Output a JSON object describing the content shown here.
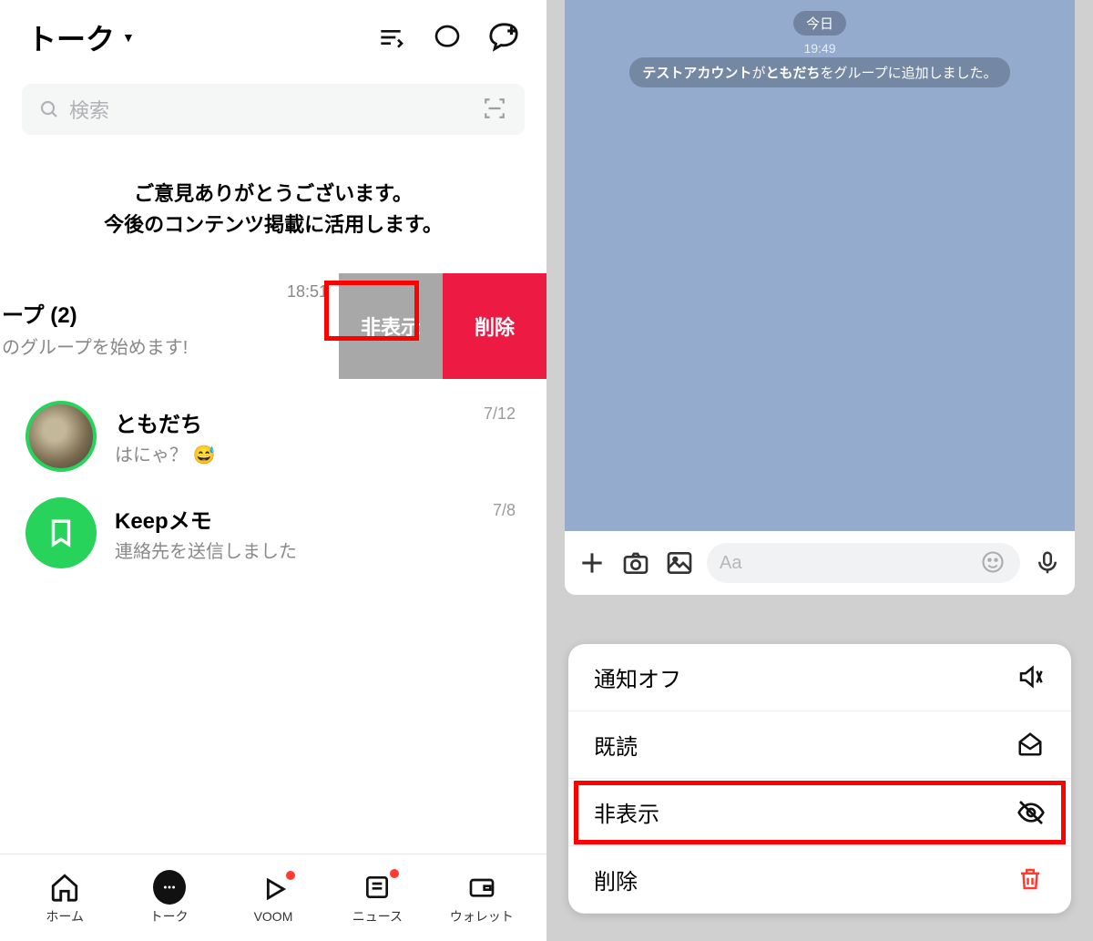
{
  "left": {
    "title": "トーク",
    "search_placeholder": "検索",
    "feedback_line1": "ご意見ありがとうございます。",
    "feedback_line2": "今後のコンテンツ掲載に活用します。",
    "swiped_item": {
      "name_fragment": "ープ (2)",
      "msg_fragment": "のグループを始めます!",
      "time": "18:51",
      "action_hide": "非表示",
      "action_delete": "削除"
    },
    "chats": [
      {
        "name": "ともだち",
        "msg": "はにゃ？ 😅",
        "date": "7/12"
      },
      {
        "name": "Keepメモ",
        "msg": "連絡先を送信しました",
        "date": "7/8"
      }
    ],
    "tabs": {
      "home": "ホーム",
      "talk": "トーク",
      "voom": "VOOM",
      "news": "ニュース",
      "wallet": "ウォレット"
    }
  },
  "right": {
    "date_label": "今日",
    "sys_time": "19:49",
    "sys_msg_user": "テストアカウント",
    "sys_msg_mid1": "が",
    "sys_msg_friend": "ともだち",
    "sys_msg_mid2": "をグループに追加しました。",
    "input_placeholder": "Aa",
    "menu": {
      "mute": "通知オフ",
      "read": "既読",
      "hide": "非表示",
      "delete": "削除"
    }
  }
}
